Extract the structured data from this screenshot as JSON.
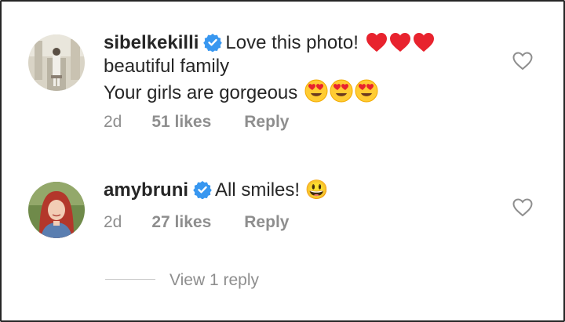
{
  "comments": [
    {
      "username": "sibelkekilli",
      "verified": true,
      "lines": [
        "Love this photo!",
        "beautiful family",
        "Your girls are gorgeous"
      ],
      "emojis_line1": [
        "red-heart",
        "red-heart",
        "red-heart"
      ],
      "emojis_line3": [
        "heart-eyes",
        "heart-eyes",
        "heart-eyes"
      ],
      "time": "2d",
      "likes": "51 likes",
      "reply": "Reply"
    },
    {
      "username": "amybruni",
      "verified": true,
      "text": "All smiles! 😃",
      "time": "2d",
      "likes": "27 likes",
      "reply": "Reply"
    }
  ],
  "view_replies": "View 1 reply",
  "colors": {
    "verified": "#3897f0",
    "heart": "#ed4956",
    "meta": "#8e8e8e"
  }
}
